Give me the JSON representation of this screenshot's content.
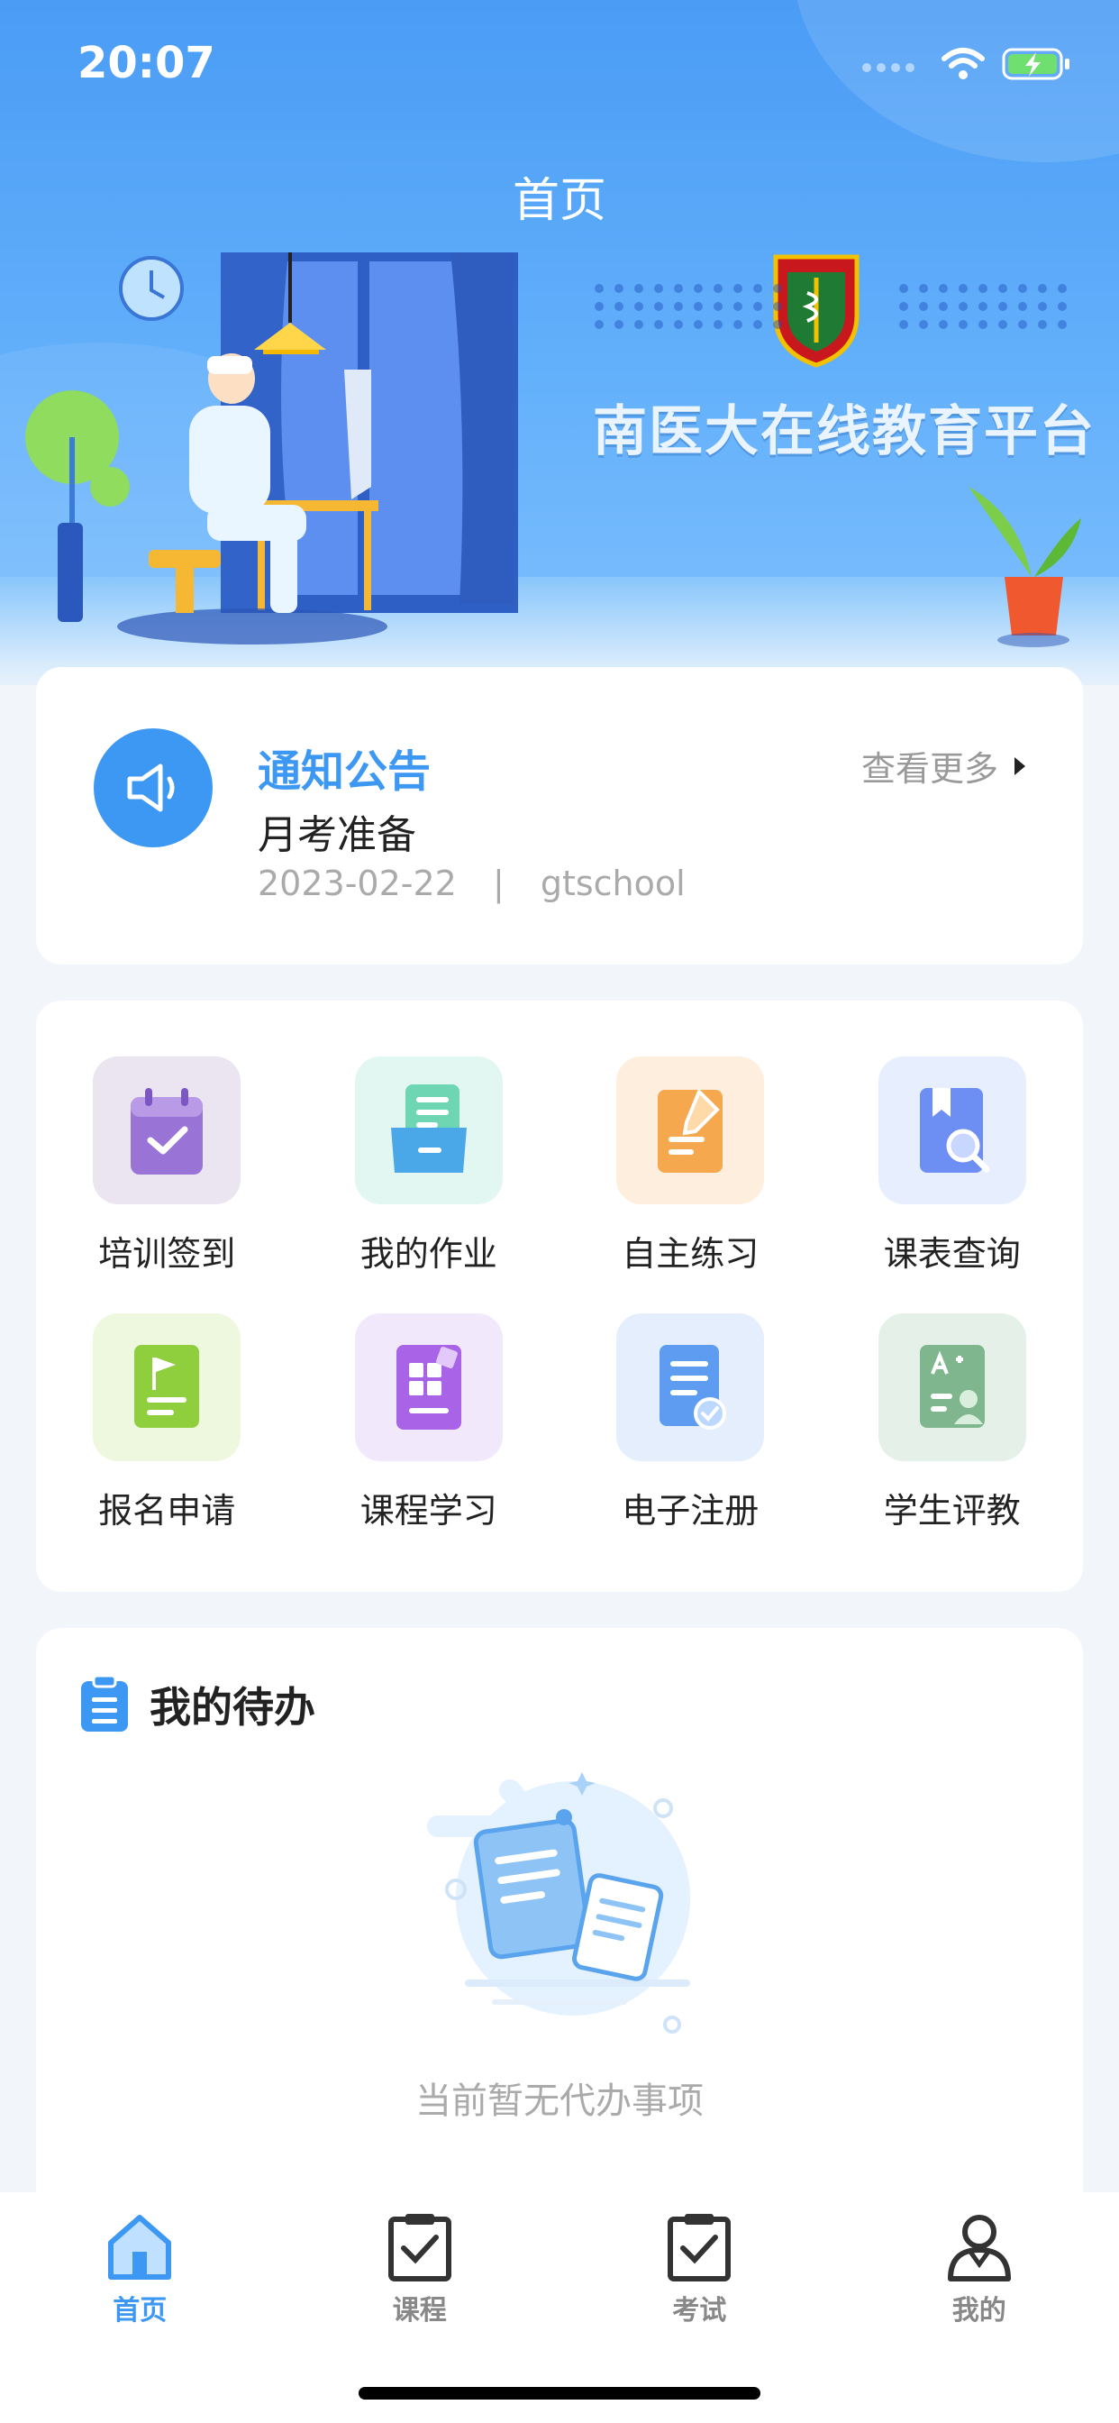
{
  "status_bar": {
    "time": "20:07"
  },
  "header": {
    "title": "首页",
    "brand": "南医大在线教育平台"
  },
  "notice": {
    "title": "通知公告",
    "more_label": "查看更多",
    "subject": "月考准备",
    "date": "2023-02-22",
    "separator": "|",
    "author": "gtschool"
  },
  "features": [
    {
      "label": "培训签到",
      "icon": "calendar-check-icon",
      "tile_color": "#ebe4f1"
    },
    {
      "label": "我的作业",
      "icon": "homework-icon",
      "tile_color": "#e2f7f1"
    },
    {
      "label": "自主练习",
      "icon": "practice-pencil-icon",
      "tile_color": "#fdeedd"
    },
    {
      "label": "课表查询",
      "icon": "schedule-search-icon",
      "tile_color": "#e7efff"
    },
    {
      "label": "报名申请",
      "icon": "enroll-flag-icon",
      "tile_color": "#eef8df"
    },
    {
      "label": "课程学习",
      "icon": "course-study-icon",
      "tile_color": "#f2e8fc"
    },
    {
      "label": "电子注册",
      "icon": "e-register-icon",
      "tile_color": "#e4eefc"
    },
    {
      "label": "学生评教",
      "icon": "student-evaluation-icon",
      "tile_color": "#e5f1e8"
    }
  ],
  "todo": {
    "title": "我的待办",
    "empty_text": "当前暂无代办事项"
  },
  "tabbar": {
    "items": [
      {
        "label": "首页",
        "icon": "home-icon",
        "active": true
      },
      {
        "label": "课程",
        "icon": "clipboard-check-icon",
        "active": false
      },
      {
        "label": "考试",
        "icon": "clipboard-check-icon",
        "active": false
      },
      {
        "label": "我的",
        "icon": "person-icon",
        "active": false
      }
    ]
  },
  "colors": {
    "accent": "#3d98f3",
    "hero_top": "#4a9cf5"
  }
}
